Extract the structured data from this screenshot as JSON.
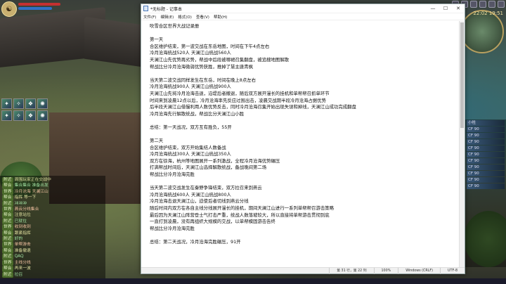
{
  "notepad": {
    "title": "*无标题 - 记事本",
    "menu": [
      "文件(F)",
      "编辑(E)",
      "格式(O)",
      "查看(V)",
      "帮助(H)"
    ],
    "lines": [
      "吹雪合区世界大战记录册",
      "",
      "第一天",
      "合区维护结束，第一波交战在东岳地图，时间在下午4点左右",
      "冷月沧海统战520人  天澜江山统战560人",
      "天澜江山先优势再劣势，帮战中后段被哪裙召集翻盘，被追搜地图解散",
      "帮战比分冷月沧海微弱优势获胜，推掉了慧主唐青枫",
      "",
      "当天第二波交战同样发生在东岳，时间在晚上8点左右",
      "冷月沧海统战900人  天澜江山统战900人",
      "天澜江山先将冷月沧海击退，沿堤后者撤退，随后双方展开漫长的挂机和单帮帮召抓单环节",
      "时间来到凌晨12点以后，冷月沧海率先反应过围出击，凌晨交战期半段冷月沧海占据优势",
      "后半段天澜江山借慢利用人数优势反击，同时冷月沧海召集开始出现失误和掉线，天澜江山成功完成翻盘",
      "冷月沧海先行解散统战，帮战比分天澜江山小胜",
      "",
      "总结：第一天战况，双方互有胜负，55开",
      "",
      "第二天",
      "合区维护结束，双方开始集结人数备战",
      "冷月沧海统战300人  天澜江山统战350人",
      "双方在徐海，杭州等地图展开一系列激战，全程冷月沧海优势碾压",
      "打满帮战时间后，天澜江山选择解散统战，备战晚间第二场",
      "帮战比分冷月沧海完胜",
      "",
      "当天第二波交战发生在秦野争锋结束，双方拉召来到燕云",
      "冷月沧海统战600人  天澜江山统战800人",
      "冷月沧海击退天澜江山，迫使后者切线到燕云分线",
      "随后时间内双方在各自主线分线展开漫长的挂机，期间天澜江山进行一系列单帮帮召游击策略",
      "最后因为天澜江山阵营登士气打击严重，统战人数落坡较大，所以直接将单帮游击贯彻到底",
      "一直打到凌晨，没有再组织大规模的交战，以单帮模固游击告终",
      "帮战比分冷月沧海完胜",
      "",
      "总结：第二天战况，冷月沧海完胜碾压，91开"
    ],
    "status": {
      "position": "第 31 行，第 22 列",
      "zoom": "100%",
      "eol": "Windows (CRLF)",
      "encoding": "UTF-8"
    }
  },
  "game": {
    "time": "22:02 19:51",
    "chat": [
      {
        "tag": "附近",
        "text": "周围玩家正在交战中"
      },
      {
        "tag": "帮会",
        "text": "集合集合 准备出发"
      },
      {
        "tag": "世界",
        "text": "冷月沧海 天澜江山"
      },
      {
        "tag": "帮会",
        "text": "指挥 等一下"
      },
      {
        "tag": "附近",
        "text": "冲冲冲"
      },
      {
        "tag": "世界",
        "text": "燕云分线集合"
      },
      {
        "tag": "帮会",
        "text": "注意站位"
      },
      {
        "tag": "附近",
        "text": "已就位"
      },
      {
        "tag": "世界",
        "text": "收到收到"
      },
      {
        "tag": "帮会",
        "text": "跟紧指挥"
      },
      {
        "tag": "附近",
        "text": "好的"
      },
      {
        "tag": "世界",
        "text": "单帮游击"
      },
      {
        "tag": "帮会",
        "text": "准备撤退"
      },
      {
        "tag": "附近",
        "text": "QAQ"
      },
      {
        "tag": "世界",
        "text": "主线分线"
      },
      {
        "tag": "帮会",
        "text": "再来一波"
      },
      {
        "tag": "附近",
        "text": "拉召"
      }
    ],
    "team": [
      "小牲",
      "CF 90",
      "CF 90",
      "CF 90",
      "CF 90",
      "CF 90",
      "CF 90",
      "CF 90",
      "CF 90",
      "CF 90",
      "CF 90"
    ]
  }
}
